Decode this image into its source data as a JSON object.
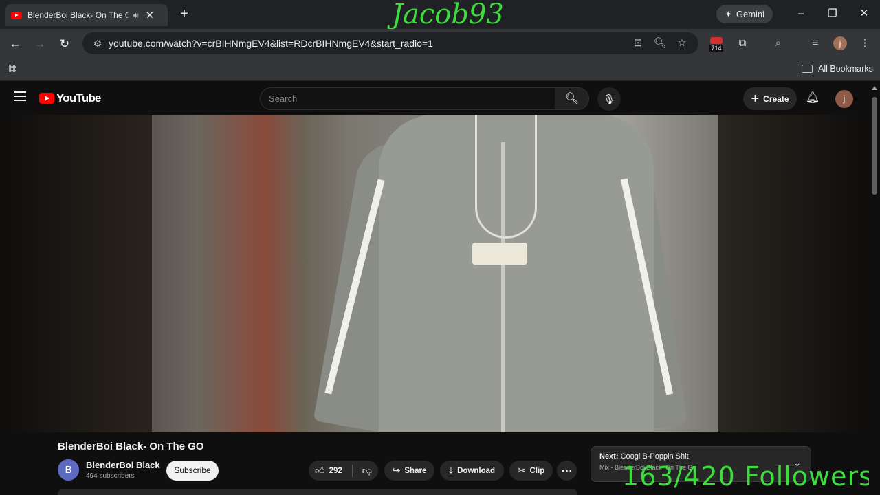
{
  "browser": {
    "tab": {
      "title": "BlenderBoi Black- On The G",
      "close": "✕"
    },
    "new_tab": "+",
    "overlay_user": "Jacob93",
    "gemini_label": "Gemini",
    "window": {
      "minimize": "–",
      "maximize": "❐",
      "close": "✕"
    },
    "nav": {
      "back": "←",
      "forward": "→",
      "reload": "↻"
    },
    "url": "youtube.com/watch?v=crBIHNmgEV4&list=RDcrBIHNmgEV4&start_radio=1",
    "extension_badge": "714",
    "profile_initial": "j",
    "bookmarks_label": "All Bookmarks"
  },
  "youtube": {
    "logo_text": "YouTube",
    "search": {
      "placeholder": "Search"
    },
    "create_label": "Create",
    "avatar_initial": "j",
    "video": {
      "title": "BlenderBoi Black- On The GO",
      "channel": "BlenderBoi Black",
      "channel_initial": "B",
      "subscribers": "494 subscribers",
      "subscribe_label": "Subscribe",
      "likes": "292",
      "share_label": "Share",
      "download_label": "Download",
      "clip_label": "Clip"
    },
    "next": {
      "prefix": "Next:",
      "title": "Coogi B-Poppin Shit",
      "subtitle": "Mix - BlenderBoi Black- On The G"
    },
    "followers_overlay": "163/420 Followers"
  },
  "colors": {
    "overlay_green": "#3ddc3d",
    "youtube_red": "#ff0000",
    "background": "#0f0f0f"
  }
}
